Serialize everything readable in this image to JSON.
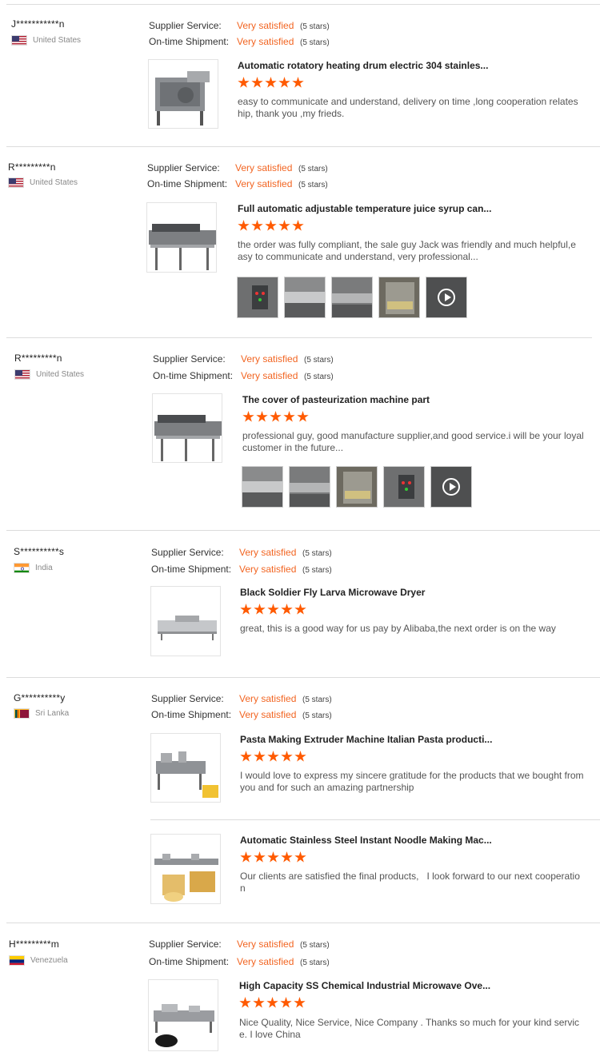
{
  "labels": {
    "supplier_service": "Supplier Service:",
    "ontime_shipment": "On-time Shipment:",
    "very_satisfied": "Very satisfied",
    "five_stars": "(5 stars)"
  },
  "colors": {
    "accent": "#f26522",
    "star": "#ff5a00"
  },
  "reviews": [
    {
      "buyer": "J***********n",
      "country": "United States",
      "flag": "us-flag-icon",
      "products": [
        {
          "title": "Automatic rotatory heating drum electric 304 stainles...",
          "rating": 5,
          "comment": "easy to communicate and understand, delivery on time ,long cooperation relateship, thank you ,my frieds."
        }
      ]
    },
    {
      "buyer": "R*********n",
      "country": "United States",
      "flag": "us-flag-icon",
      "products": [
        {
          "title": "Full automatic adjustable temperature juice syrup can...",
          "rating": 5,
          "comment": "the order was fully compliant, the sale guy Jack was friendly and much helpful,easy to communicate and understand, very professional..."
        }
      ]
    },
    {
      "buyer": "R*********n",
      "country": "United States",
      "flag": "us-flag-icon",
      "products": [
        {
          "title": "The cover of pasteurization machine part",
          "rating": 5,
          "comment": "professional guy, good manufacture supplier,and good service.i will be your loyal customer in the future..."
        }
      ]
    },
    {
      "buyer": "S**********s",
      "country": "India",
      "flag": "india-flag-icon",
      "products": [
        {
          "title": "Black Soldier Fly Larva Microwave Dryer",
          "rating": 5,
          "comment": "great, this is a good way for us pay by Alibaba,the next order is on the way"
        }
      ]
    },
    {
      "buyer": "G**********y",
      "country": "Sri Lanka",
      "flag": "sri-lanka-flag-icon",
      "products": [
        {
          "title": "Pasta Making Extruder Machine Italian Pasta producti...",
          "rating": 5,
          "comment": "I would love to express my sincere gratitude for the products that we bought from you and for such an amazing partnership"
        },
        {
          "title": "Automatic Stainless Steel Instant Noodle Making Mac...",
          "rating": 5,
          "comment": "Our clients are satisfied the final products,   I look forward to our next cooperation"
        }
      ]
    },
    {
      "buyer": "H*********m",
      "country": "Venezuela",
      "flag": "venezuela-flag-icon",
      "products": [
        {
          "title": "High Capacity SS Chemical Industrial Microwave Ove...",
          "rating": 5,
          "comment": "Nice Quality, Nice Service, Nice Company . Thanks so much for your kind service. I love China"
        }
      ]
    }
  ]
}
